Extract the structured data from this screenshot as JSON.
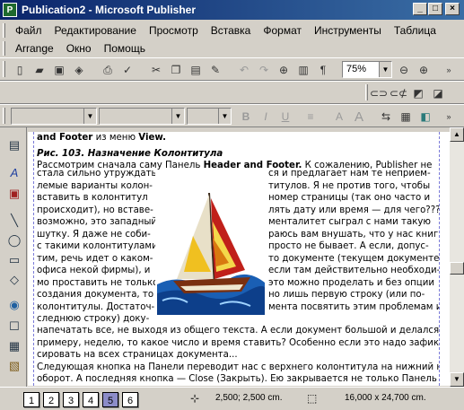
{
  "window": {
    "title": "Publication2 - Microsoft Publisher",
    "app_icon": "publisher-icon",
    "controls": {
      "minimize": "_",
      "maximize": "□",
      "close": "×"
    }
  },
  "menu": {
    "row1": [
      "Файл",
      "Редактирование",
      "Просмотр",
      "Вставка",
      "Формат",
      "Инструменты",
      "Таблица"
    ],
    "row2": [
      "Arrange",
      "Окно",
      "Помощь"
    ]
  },
  "toolbar": {
    "zoom": "75%"
  },
  "document": {
    "line1a": "and Footer",
    "line1b": " из меню ",
    "line1c": "View.",
    "caption": "Рис. 103. Назначение Колонтитула",
    "intro_a": "Рассмотрим сначала саму Панель ",
    "intro_b": "Header and Footer.",
    "intro_c": " К сожалению, Publisher не",
    "left_col": [
      "стала сильно утруждать-",
      "лемые варианты колон-",
      "вставить в колонтитул",
      "происходит), но вставе-",
      "возможно, это западный",
      "шутку. Я даже не соби-",
      "с такими колонтитулами",
      "тим, речь идет о каком-",
      "офиса некой фирмы), и",
      "мо проставить не только",
      "создания документа, то",
      "колонтитулы. Достаточ-",
      "следнюю строку) доку-"
    ],
    "right_col": [
      "ся и предлагает нам те неприем-",
      "титулов. Я не против того, чтобы",
      "номер страницы (так оно часто и",
      "лять дату или время — для чего???",
      "менталитет сыграл с нами такую",
      "раюсь вам внушать, что у нас книг",
      "просто не бывает. А если, допус-",
      "то документе (текущем документе",
      "если там действительно необходи-",
      "это можно проделать и без опции",
      "но лишь первую строку (или по-",
      "мента посвятить этим проблемам и",
      ""
    ],
    "full_lines": [
      "напечатать все, не выходя из общего текста. А если документ большой и делался, к",
      "примеру, неделю, то какое число и время ставить? Особенно если это надо зафик-",
      "сировать на всех страницах документа...",
      "Следующая кнопка на Панели переводит нас с верхнего колонтитула на нижний на-",
      "оборот. А последняя кнопка — Close (Закрыть). Ею закрывается не только Панель"
    ]
  },
  "statusbar": {
    "pages": [
      "1",
      "2",
      "3",
      "4",
      "5",
      "6"
    ],
    "current_page": "5",
    "position": "2,500; 2,500 cm.",
    "size": "16,000 x 24,700 cm."
  }
}
